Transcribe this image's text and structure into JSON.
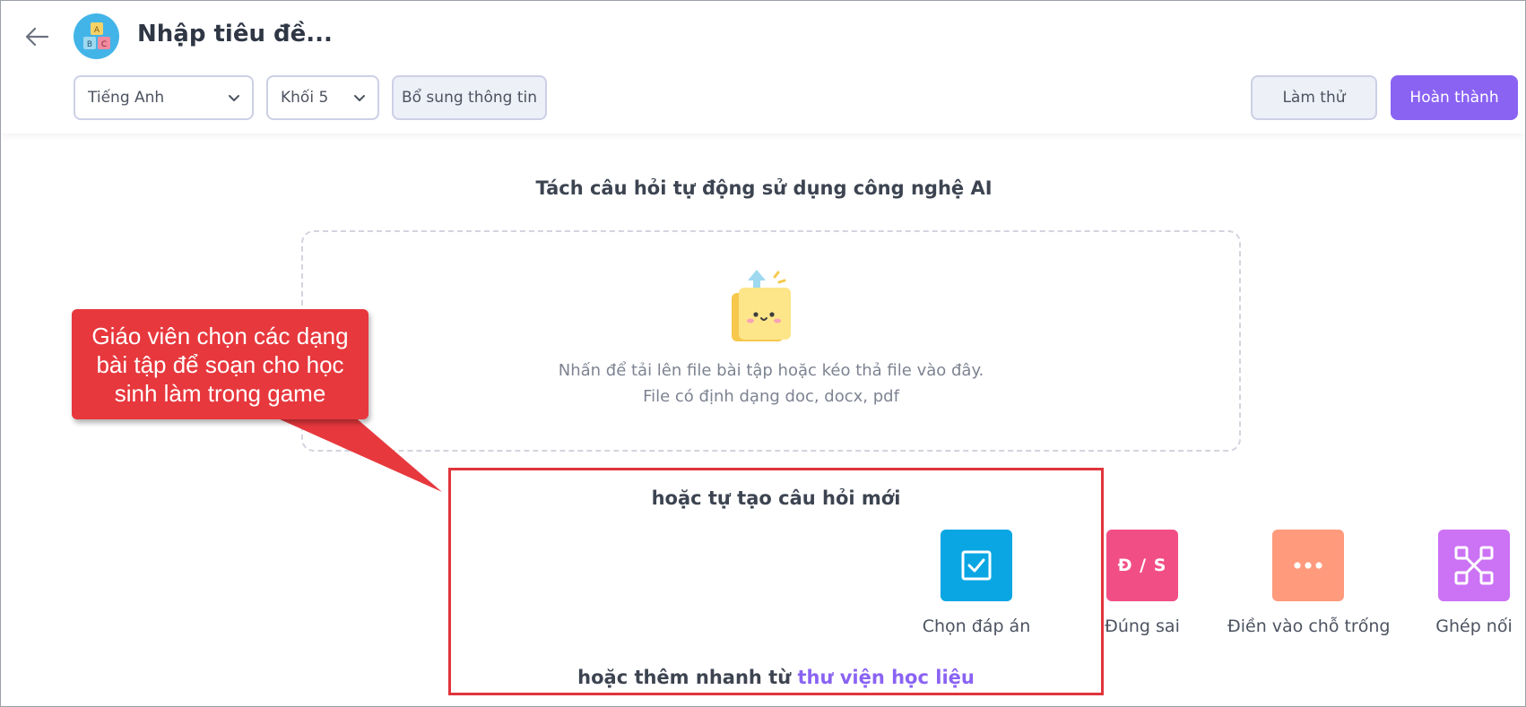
{
  "header": {
    "title": "Nhập tiêu đề...",
    "subject_select": "Tiếng Anh",
    "grade_select": "Khối 5",
    "extra_info_label": "Bổ sung thông tin",
    "try_label": "Làm thử",
    "done_label": "Hoàn thành"
  },
  "upload": {
    "title": "Tách câu hỏi tự động sử dụng công nghệ AI",
    "line1": "Nhấn để tải lên file bài tập hoặc kéo thả file vào đây.",
    "line2": "File có định dạng doc, docx, pdf"
  },
  "create": {
    "title": "hoặc tự tạo câu hỏi mới",
    "types": [
      {
        "label": "Chọn đáp án",
        "icon": "checkbox-icon"
      },
      {
        "label": "Đúng sai",
        "icon_text": "Đ / S"
      },
      {
        "label": "Điền vào chỗ trống",
        "icon": "ellipsis-icon"
      },
      {
        "label": "Ghép nối",
        "icon": "match-nodes-icon"
      }
    ],
    "library_prefix": "hoặc thêm nhanh từ",
    "library_link": "thư viện học liệu"
  },
  "callout": {
    "text": "Giáo viên chọn các dạng bài tập để soạn cho học sinh làm trong game"
  },
  "colors": {
    "accent": "#8a63f3",
    "callout": "#e7383d",
    "choice": "#0aa6e4",
    "truefalse": "#f24e86",
    "fill": "#ff9a7d",
    "match": "#cc72f5"
  }
}
